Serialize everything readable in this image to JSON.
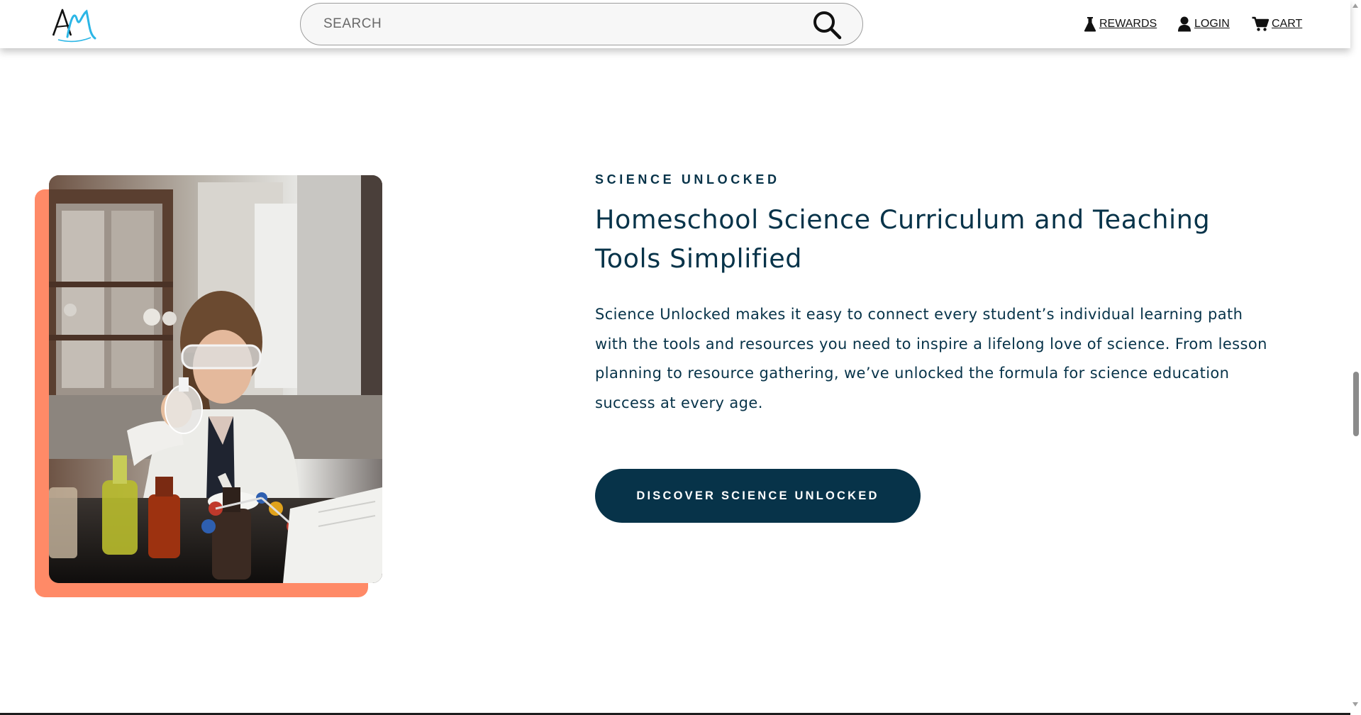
{
  "header": {
    "logo_text": "AM",
    "search": {
      "placeholder": "SEARCH"
    },
    "nav": {
      "rewards": {
        "label": "REWARDS",
        "icon": "flask-icon"
      },
      "login": {
        "label": "LOGIN",
        "icon": "user-icon"
      },
      "cart": {
        "label": "CART",
        "icon": "cart-icon"
      }
    }
  },
  "hero": {
    "eyebrow": "SCIENCE UNLOCKED",
    "headline": "Homeschool Science Curriculum and Teaching Tools Simplified",
    "body": "Science Unlocked makes it easy to connect every student’s individual learning path with the tools and resources you need to inspire a lifelong love of science. From lesson planning to resource gathering, we’ve unlocked the formula for science education success at every age.",
    "cta_label": "DISCOVER SCIENCE UNLOCKED",
    "image": "girl-in-science-lab-photo"
  },
  "colors": {
    "navy": "#073349",
    "accent_coral": "#ff8a67",
    "logo_blue": "#2bb6e6",
    "white": "#ffffff"
  }
}
